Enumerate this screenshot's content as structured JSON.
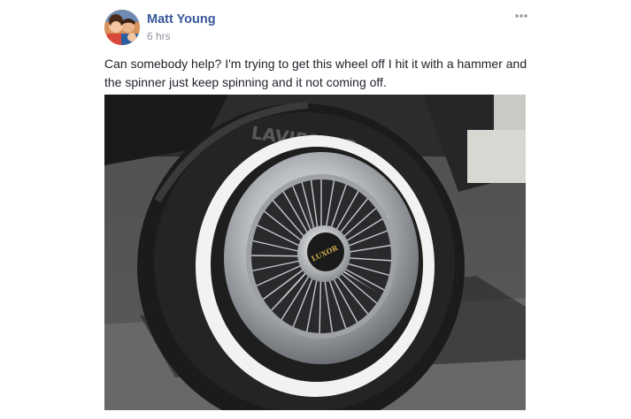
{
  "post": {
    "author": "Matt Young",
    "timestamp": "6 hrs",
    "text": "Can somebody help? I'm trying to get this wheel off I hit it with a hammer and the spinner just keep spinning and it not coming off.",
    "menu_icon": "more-horizontal-icon",
    "photo": {
      "tire_brand": "LAVIESTAR",
      "hub_badge": "LUXOR"
    }
  }
}
